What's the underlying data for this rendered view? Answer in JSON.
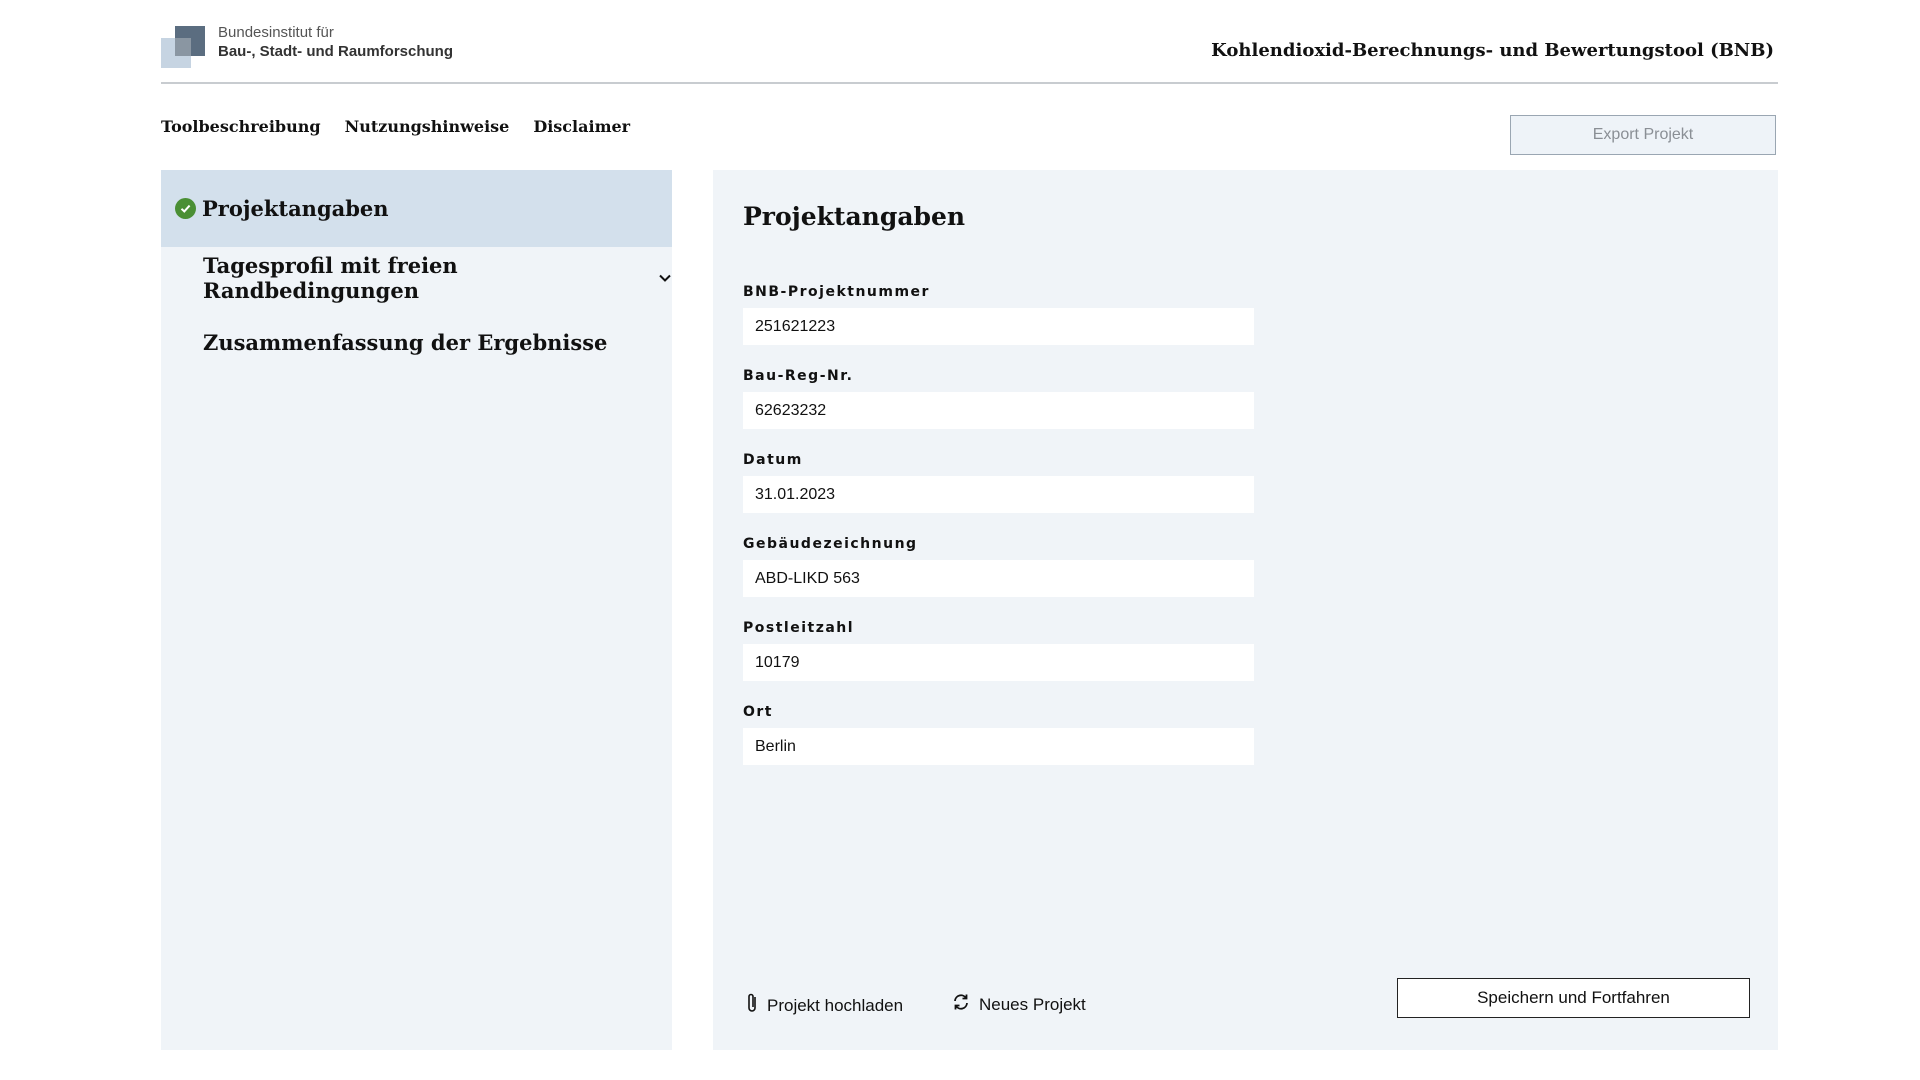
{
  "header": {
    "logo_line1": "Bundesinstitut für",
    "logo_line2": "Bau-, Stadt- und Raumforschung",
    "app_title": "Kohlendioxid-Berechnungs- und Bewertungstool (BNB)"
  },
  "topnav": {
    "items": [
      "Toolbeschreibung",
      "Nutzungshinweise",
      "Disclaimer"
    ]
  },
  "toolbar": {
    "export_label": "Export Projekt"
  },
  "sidebar": {
    "items": [
      {
        "label": "Projektangaben",
        "status": "complete"
      },
      {
        "label": "Tagesprofil mit freien Randbedingungen"
      },
      {
        "label": "Zusammenfassung der Ergebnisse"
      }
    ]
  },
  "main": {
    "title": "Projektangaben",
    "fields": [
      {
        "label": "BNB-Projektnummer",
        "value": "251621223"
      },
      {
        "label": "Bau-Reg-Nr.",
        "value": "62623232"
      },
      {
        "label": "Datum",
        "value": "31.01.2023"
      },
      {
        "label": "Gebäudezeichnung",
        "value": "ABD-LIKD 563"
      },
      {
        "label": "Postleitzahl",
        "value": "10179"
      },
      {
        "label": "Ort",
        "value": "Berlin"
      }
    ],
    "upload_label": "Projekt hochladen",
    "new_label": "Neues Projekt",
    "save_label": "Speichern und Fortfahren"
  },
  "colors": {
    "panel_bg": "#f0f4f8",
    "active_nav_bg": "#d3e0ec",
    "check_green": "#4a8f34"
  },
  "icons": {
    "check": "check-circle-icon",
    "chevron": "chevron-down-icon",
    "upload": "paperclip-icon",
    "new": "refresh-icon"
  }
}
